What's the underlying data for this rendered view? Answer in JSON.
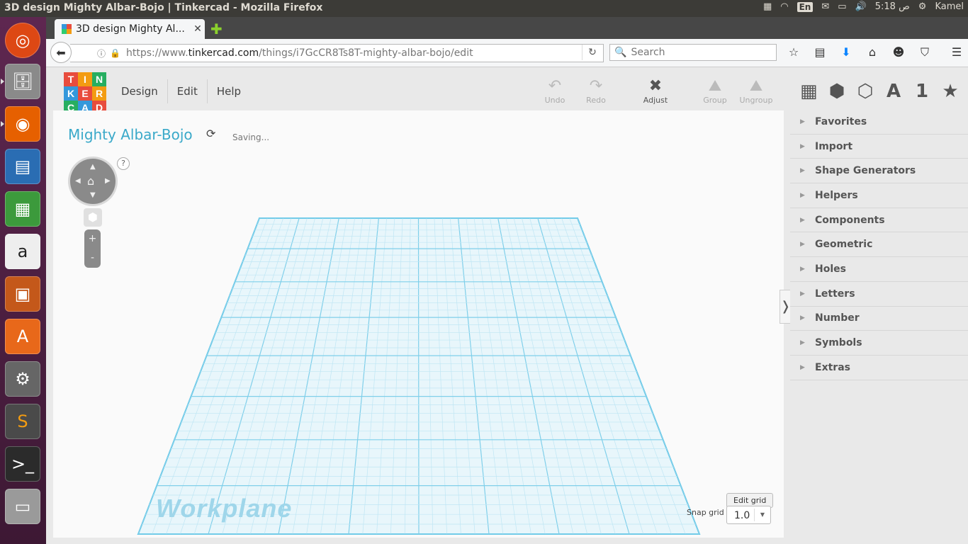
{
  "window": {
    "title": "3D design Mighty Albar-Bojo | Tinkercad - Mozilla Firefox"
  },
  "panel": {
    "lang": "En",
    "time": "5:18 ص",
    "user": "Kamel"
  },
  "browser": {
    "tab_title": "3D design Mighty Al...",
    "url_scheme": "https://www.",
    "url_host": "tinkercad.com",
    "url_path": "/things/i7GcCR8Ts8T-mighty-albar-bojo/edit",
    "search_placeholder": "Search"
  },
  "logo": [
    "T",
    "I",
    "N",
    "K",
    "E",
    "R",
    "C",
    "A",
    "D"
  ],
  "logo_colors": [
    "#e84c3d",
    "#f39c12",
    "#27ae60",
    "#3498db",
    "#e84c3d",
    "#f39c12",
    "#27ae60",
    "#3498db",
    "#e84c3d"
  ],
  "menu": {
    "design": "Design",
    "edit": "Edit",
    "help": "Help"
  },
  "toolbar": {
    "undo": "Undo",
    "redo": "Redo",
    "adjust": "Adjust",
    "group": "Group",
    "ungroup": "Ungroup"
  },
  "design": {
    "title": "Mighty Albar-Bojo",
    "status": "Saving..."
  },
  "viewport": {
    "help": "?",
    "zoom_in": "+",
    "zoom_out": "-",
    "workplane_label": "Workplane",
    "edit_grid": "Edit grid",
    "snap_grid_label": "Snap grid",
    "snap_grid_value": "1.0"
  },
  "right_panel": {
    "icon_letter": "A",
    "icon_number": "1",
    "categories": [
      "Favorites",
      "Import",
      "Shape Generators",
      "Helpers",
      "Components",
      "Geometric",
      "Holes",
      "Letters",
      "Number",
      "Symbols",
      "Extras"
    ]
  }
}
